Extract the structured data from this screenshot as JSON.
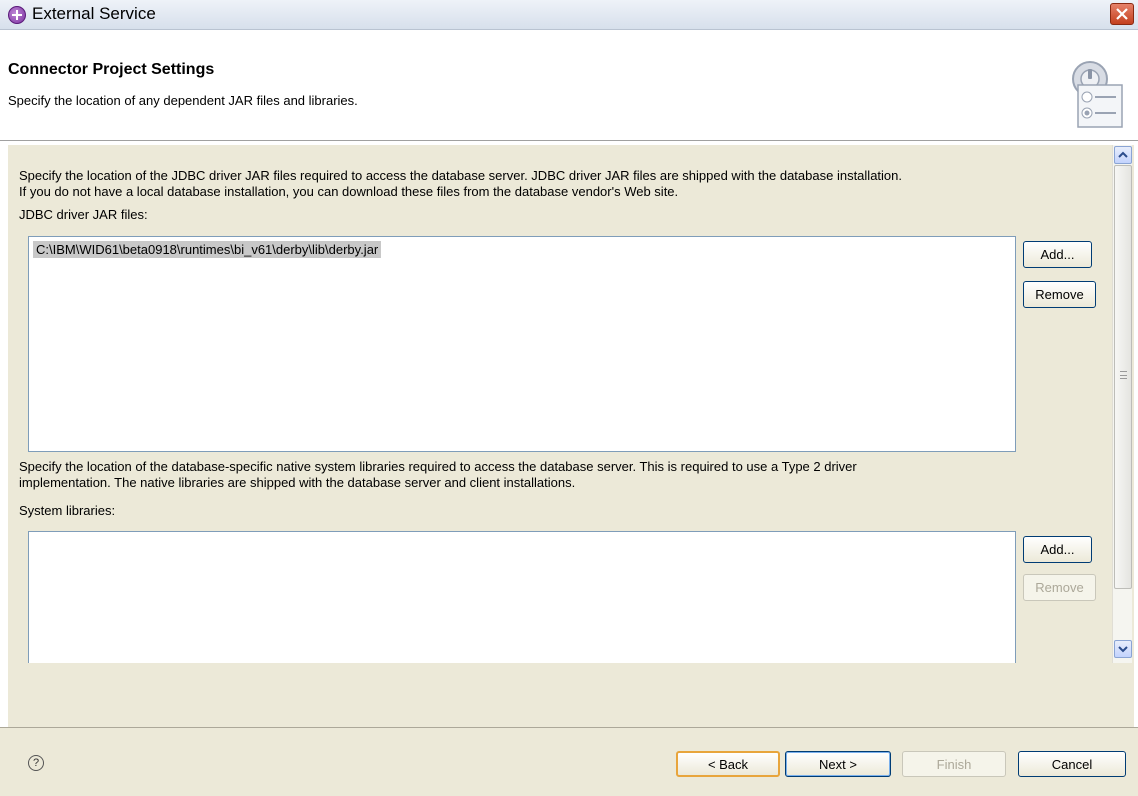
{
  "window": {
    "title": "External Service"
  },
  "header": {
    "title": "Connector Project Settings",
    "description": "Specify the location of any dependent JAR files and libraries."
  },
  "jdbc": {
    "description_line1": "Specify the location of the JDBC driver JAR files required to access the database server. JDBC driver JAR files are shipped with the database installation.",
    "description_line2": "If you do not have a local database installation, you can download these files from the database vendor's Web site.",
    "label": "JDBC driver JAR files:",
    "items": [
      "C:\\IBM\\WID61\\beta0918\\runtimes\\bi_v61\\derby\\lib\\derby.jar"
    ],
    "add_label": "Add...",
    "remove_label": "Remove"
  },
  "native": {
    "description_line1": "Specify the location of the database-specific native system libraries required to access the database server. This is required to use a Type 2 driver",
    "description_line2": "implementation. The native libraries are shipped with the database server and client installations.",
    "label": "System libraries:",
    "items": [],
    "add_label": "Add...",
    "remove_label": "Remove"
  },
  "footer": {
    "help_glyph": "?",
    "back_label": "< Back",
    "next_label": "Next >",
    "finish_label": "Finish",
    "cancel_label": "Cancel"
  }
}
